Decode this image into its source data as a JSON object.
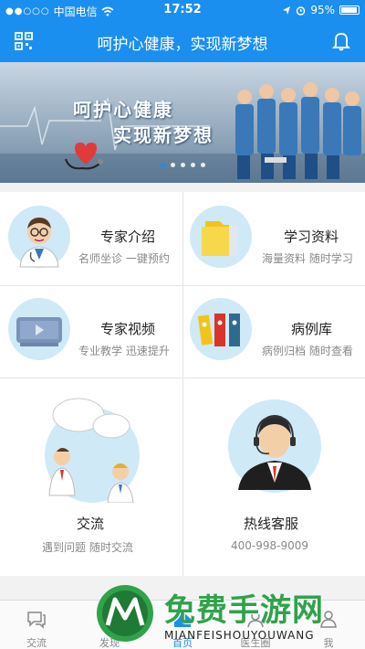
{
  "statusbar": {
    "carrier": "中国电信",
    "signal": "●●○○○",
    "time": "17:52",
    "battery": "95%"
  },
  "navbar": {
    "title": "呵护心健康，实现新梦想"
  },
  "banner": {
    "line1": "呵护心健康",
    "line2": "实现新梦想",
    "slides": 5,
    "active_slide": 1
  },
  "menu": [
    {
      "title": "专家介绍",
      "subtitle": "名师坐诊 一键预约",
      "icon": "doctor-icon"
    },
    {
      "title": "学习资料",
      "subtitle": "海量资料 随时学习",
      "icon": "folder-icon"
    },
    {
      "title": "专家视频",
      "subtitle": "专业教学 迅速提升",
      "icon": "video-icon"
    },
    {
      "title": "病例库",
      "subtitle": "病例归档 随时查看",
      "icon": "binders-icon"
    },
    {
      "title": "交流",
      "subtitle": "遇到问题 随时交流",
      "icon": "chat-people-icon"
    },
    {
      "title": "热线客服",
      "subtitle": "400-998-9009",
      "icon": "support-agent-icon"
    }
  ],
  "tabs": [
    {
      "label": "交流",
      "icon": "chat-icon"
    },
    {
      "label": "发现",
      "icon": "discover-icon"
    },
    {
      "label": "首页",
      "icon": "home-icon",
      "active": true
    },
    {
      "label": "医生圈",
      "icon": "doctor-circle-icon"
    },
    {
      "label": "我",
      "icon": "profile-icon"
    }
  ],
  "watermark": {
    "text": "免费手游网",
    "sub": "MIANFEISHOUYOUWANG"
  },
  "colors": {
    "primary": "#1b8ff0",
    "watermark": "#2fa24a"
  }
}
